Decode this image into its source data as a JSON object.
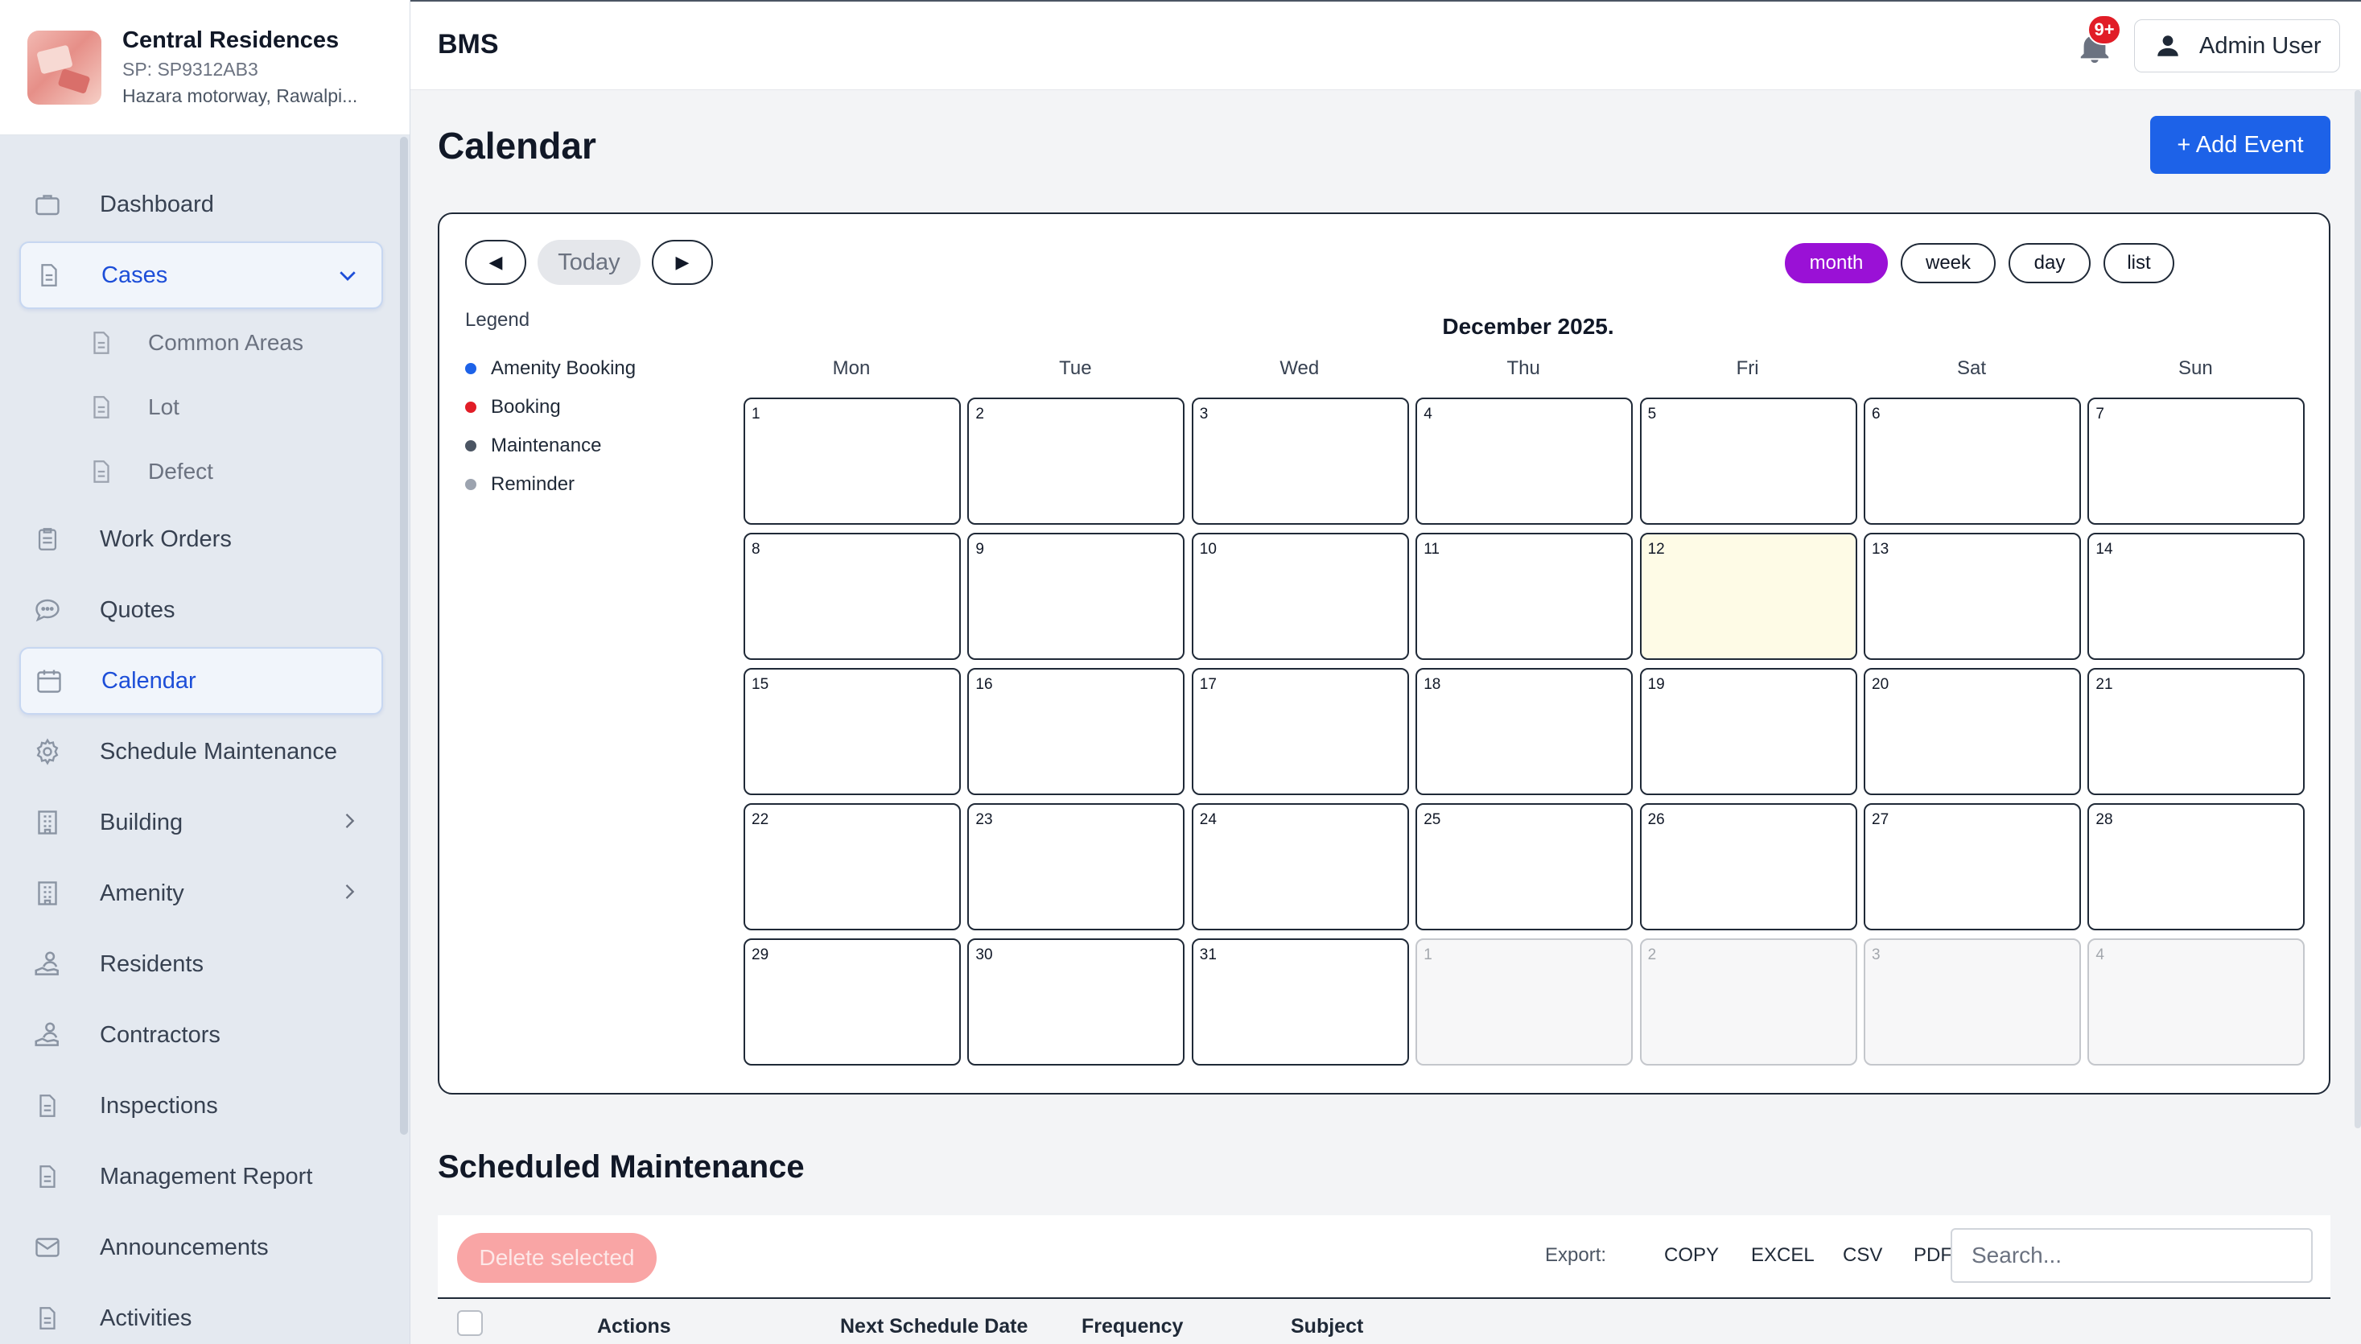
{
  "property": {
    "name": "Central Residences",
    "sp": "SP: SP9312AB3",
    "address": "Hazara motorway, Rawalpi..."
  },
  "sidebar": {
    "items": [
      {
        "label": "Dashboard",
        "icon": "briefcase-icon"
      },
      {
        "label": "Cases",
        "icon": "document-icon",
        "active": true,
        "expanded": true
      },
      {
        "label": "Common Areas",
        "icon": "document-icon",
        "sub": true
      },
      {
        "label": "Lot",
        "icon": "document-icon",
        "sub": true
      },
      {
        "label": "Defect",
        "icon": "document-icon",
        "sub": true
      },
      {
        "label": "Work Orders",
        "icon": "clipboard-icon"
      },
      {
        "label": "Quotes",
        "icon": "chat-bubble-icon"
      },
      {
        "label": "Calendar",
        "icon": "calendar-icon",
        "active": true
      },
      {
        "label": "Schedule Maintenance",
        "icon": "gear-icon"
      },
      {
        "label": "Building",
        "icon": "building-icon",
        "has_children": true
      },
      {
        "label": "Amenity",
        "icon": "building-icon",
        "has_children": true
      },
      {
        "label": "Residents",
        "icon": "people-icon"
      },
      {
        "label": "Contractors",
        "icon": "people-icon"
      },
      {
        "label": "Inspections",
        "icon": "document-icon"
      },
      {
        "label": "Management Report",
        "icon": "document-icon"
      },
      {
        "label": "Announcements",
        "icon": "envelope-icon"
      },
      {
        "label": "Activities",
        "icon": "document-icon"
      }
    ]
  },
  "topbar": {
    "brand": "BMS",
    "notification_badge": "9+",
    "user": "Admin User"
  },
  "page": {
    "title": "Calendar",
    "add_event": "+ Add Event"
  },
  "calendar": {
    "today_label": "Today",
    "prev_glyph": "◀",
    "next_glyph": "▶",
    "views": [
      "month",
      "week",
      "day",
      "list"
    ],
    "active_view": "month",
    "title": "December 2025.",
    "legend_title": "Legend",
    "legend": [
      {
        "label": "Amenity Booking",
        "color": "#1d62e8"
      },
      {
        "label": "Booking",
        "color": "#e11d27"
      },
      {
        "label": "Maintenance",
        "color": "#4b5563"
      },
      {
        "label": "Reminder",
        "color": "#9ca3af"
      }
    ],
    "weekdays": [
      "Mon",
      "Tue",
      "Wed",
      "Thu",
      "Fri",
      "Sat",
      "Sun"
    ],
    "weeks": [
      [
        "1",
        "2",
        "3",
        "4",
        "5",
        "6",
        "7"
      ],
      [
        "8",
        "9",
        "10",
        "11",
        "12",
        "13",
        "14"
      ],
      [
        "15",
        "16",
        "17",
        "18",
        "19",
        "20",
        "21"
      ],
      [
        "22",
        "23",
        "24",
        "25",
        "26",
        "27",
        "28"
      ],
      [
        "29",
        "30",
        "31",
        "1",
        "2",
        "3",
        "4"
      ]
    ],
    "today_date": "12",
    "other_month_cells": [
      [
        4,
        3
      ],
      [
        4,
        4
      ],
      [
        4,
        5
      ],
      [
        4,
        6
      ]
    ]
  },
  "scheduled": {
    "title": "Scheduled Maintenance",
    "delete_selected": "Delete selected",
    "export_label": "Export:",
    "export_buttons": [
      "COPY",
      "EXCEL",
      "CSV",
      "PDF"
    ],
    "search_placeholder": "Search...",
    "columns": [
      "Actions",
      "Next Schedule Date",
      "Frequency",
      "Subject"
    ]
  }
}
